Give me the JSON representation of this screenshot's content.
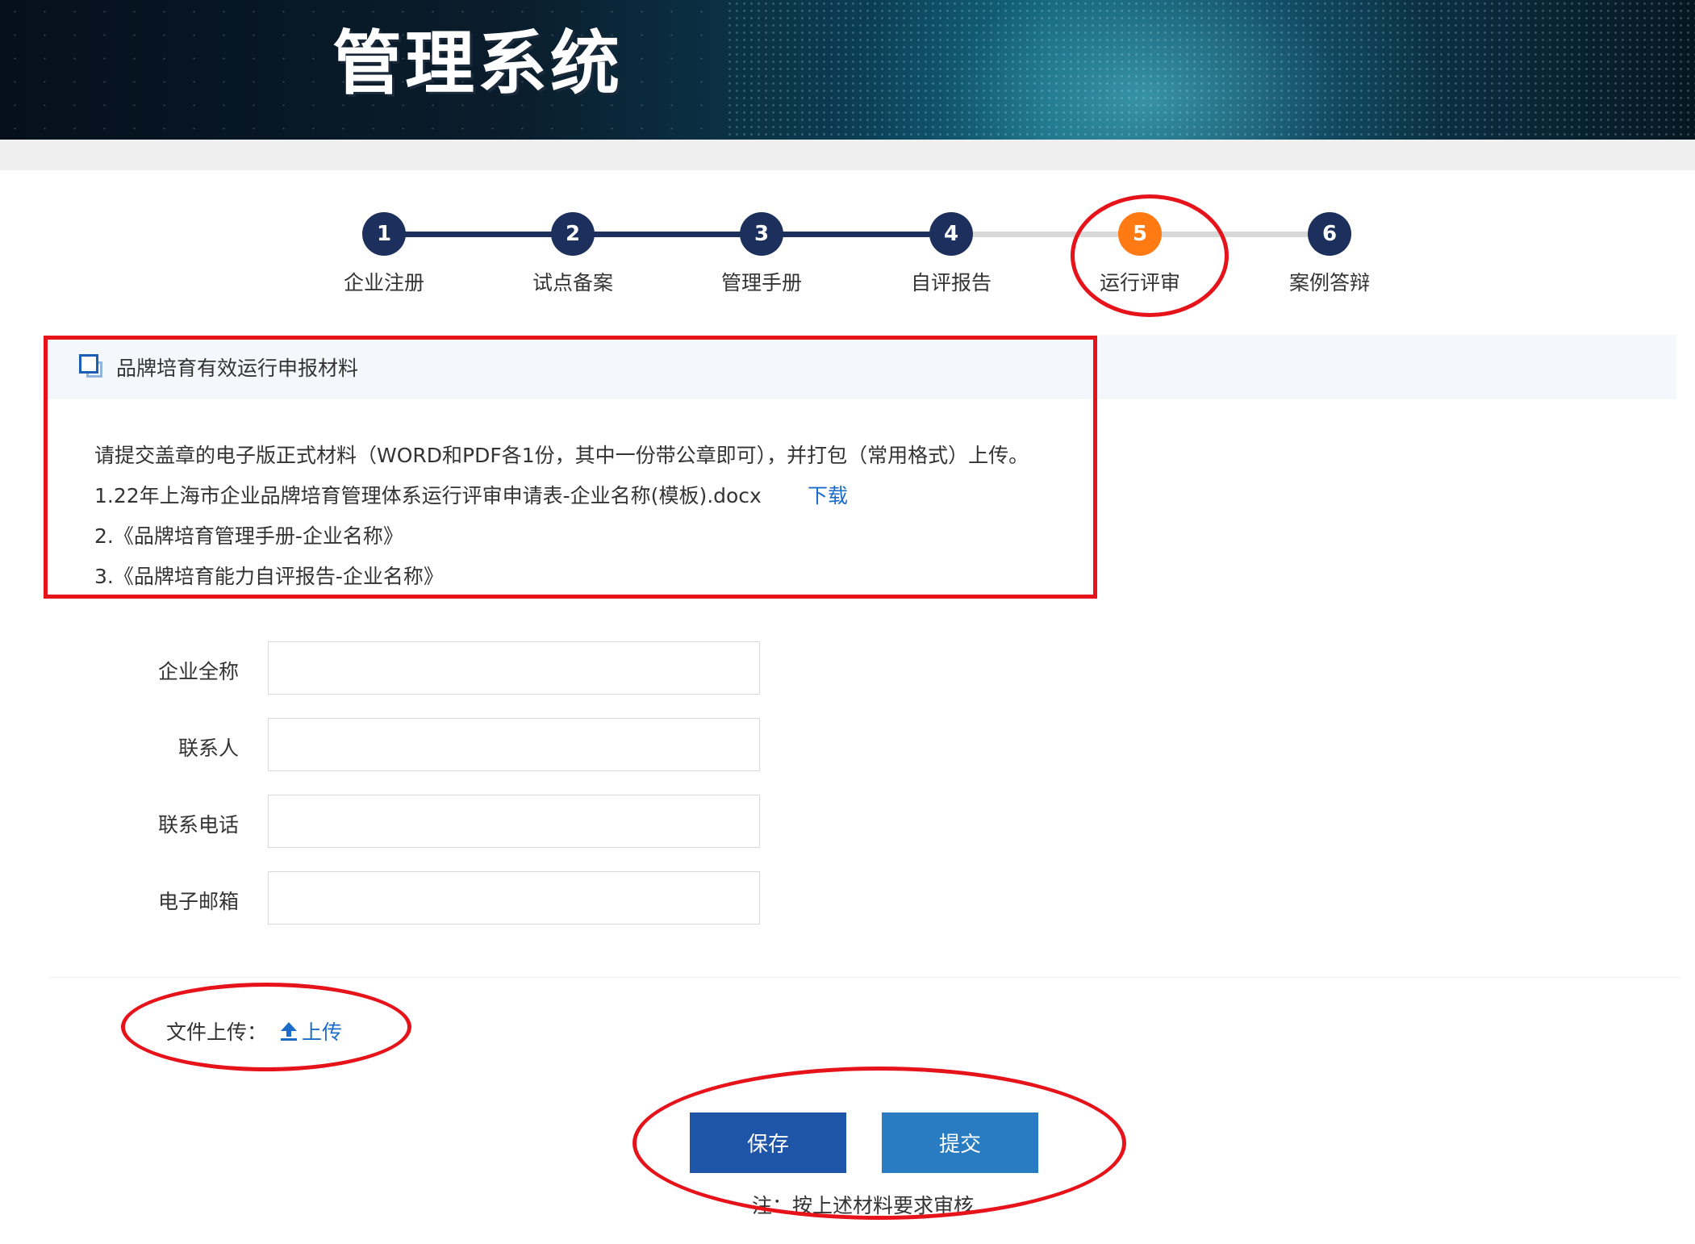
{
  "header": {
    "title": "管理系统"
  },
  "steps": [
    {
      "number": "1",
      "label": "企业注册",
      "status": "done"
    },
    {
      "number": "2",
      "label": "试点备案",
      "status": "done"
    },
    {
      "number": "3",
      "label": "管理手册",
      "status": "done"
    },
    {
      "number": "4",
      "label": "自评报告",
      "status": "done"
    },
    {
      "number": "5",
      "label": "运行评审",
      "status": "active"
    },
    {
      "number": "6",
      "label": "案例答辩",
      "status": "todo"
    }
  ],
  "panel": {
    "title": "品牌培育有效运行申报材料",
    "instruction": "请提交盖章的电子版正式材料（WORD和PDF各1份，其中一份带公章即可），并打包（常用格式）上传。",
    "items": [
      {
        "text": "1.22年上海市企业品牌培育管理体系运行评审申请表-企业名称(模板).docx",
        "link": "下载"
      },
      {
        "text": "2.《品牌培育管理手册-企业名称》"
      },
      {
        "text": "3.《品牌培育能力自评报告-企业名称》"
      }
    ]
  },
  "form": {
    "fields": [
      {
        "label": "企业全称",
        "value": ""
      },
      {
        "label": "联系人",
        "value": ""
      },
      {
        "label": "联系电话",
        "value": ""
      },
      {
        "label": "电子邮箱",
        "value": ""
      }
    ]
  },
  "upload": {
    "label": "文件上传：",
    "link": "上传"
  },
  "actions": {
    "save_label": "保存",
    "submit_label": "提交",
    "note": "注：按上述材料要求审核"
  },
  "colors": {
    "step_done": "#1d2f5c",
    "step_active": "#ff7a12",
    "link": "#1a6cc8",
    "save_button": "#1f55a8",
    "submit_button": "#2a7cc2",
    "annotation": "#e6131b"
  }
}
